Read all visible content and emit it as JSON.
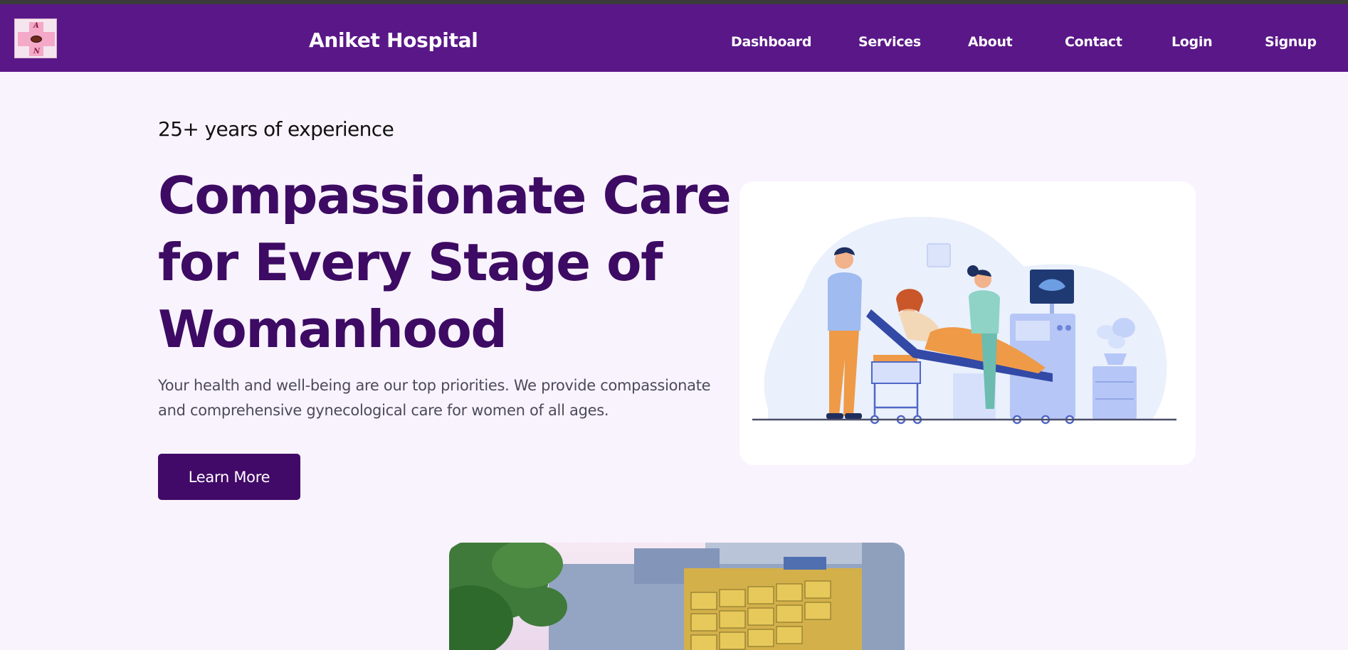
{
  "navbar": {
    "logo_letters": [
      "A",
      "N"
    ],
    "brand": "Aniket Hospital",
    "links": [
      "Dashboard",
      "Services",
      "About",
      "Contact",
      "Login",
      "Signup"
    ]
  },
  "hero": {
    "experience": "25+ years of experience",
    "headline_lines": [
      "Compassionate Care",
      "for Every Stage of",
      "Womanhood"
    ],
    "description": "Your health and well-being are our top priorities. We provide compassionate and comprehensive gynecological care for women of all ages.",
    "cta_label": "Learn More"
  },
  "colors": {
    "nav_bg": "#5a1788",
    "page_bg": "#f9f3fd",
    "headline": "#3d0b63",
    "button_bg": "#420a68"
  }
}
